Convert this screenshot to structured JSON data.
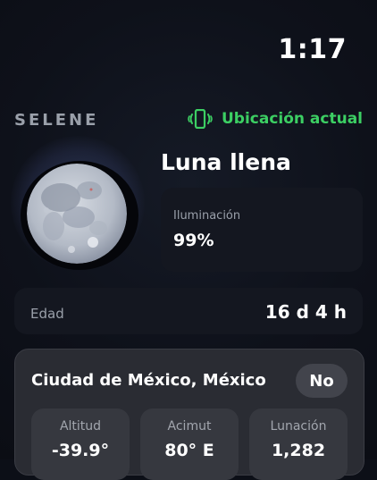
{
  "status_bar": {
    "time": "1:17"
  },
  "header": {
    "app_name": "SELENE",
    "location_label": "Ubicación actual",
    "location_icon": "phone-vibrate-icon",
    "accent_color": "#3ccf63"
  },
  "moon": {
    "phase_name": "Luna llena",
    "illumination_label": "Iluminación",
    "illumination_value": "99%",
    "age_label": "Edad",
    "age_value": "16 d 4 h"
  },
  "location_card": {
    "city": "Ciudad de México, México",
    "toggle_label": "No",
    "stats": [
      {
        "label": "Altitud",
        "value": "-39.9°"
      },
      {
        "label": "Acimut",
        "value": "80° E"
      },
      {
        "label": "Lunación",
        "value": "1,282"
      }
    ]
  }
}
